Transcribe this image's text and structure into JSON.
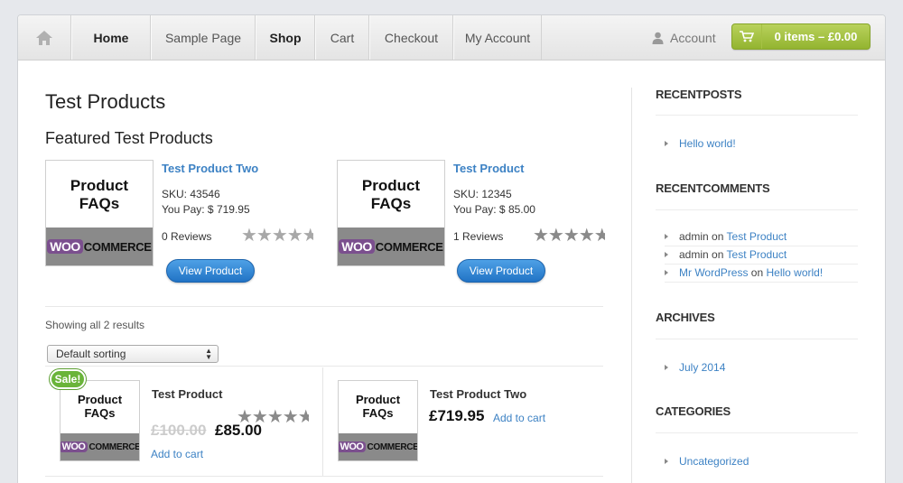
{
  "nav": {
    "items": [
      {
        "label": "Home",
        "bold": true
      },
      {
        "label": "Sample Page",
        "bold": false
      },
      {
        "label": "Shop",
        "bold": true
      },
      {
        "label": "Cart",
        "bold": false
      },
      {
        "label": "Checkout",
        "bold": false
      },
      {
        "label": "My Account",
        "bold": false
      }
    ],
    "account_label": "Account",
    "cart_label": "0 items – £0.00"
  },
  "main": {
    "page_title": "Test Products",
    "featured_title": "Featured Test Products",
    "featured": [
      {
        "name": "Test Product Two",
        "sku": "SKU: 43546",
        "price": "You Pay: $ 719.95",
        "reviews": "0 Reviews",
        "button": "View Product"
      },
      {
        "name": "Test Product",
        "sku": "SKU: 12345",
        "price": "You Pay: $ 85.00",
        "reviews": "1 Reviews",
        "button": "View Product"
      }
    ],
    "showing": "Showing all 2 results",
    "sorting_selected": "Default sorting",
    "shop": [
      {
        "name": "Test Product",
        "sale_badge": "Sale!",
        "old_price": "£100.00",
        "price": "£85.00",
        "add_to_cart": "Add to cart"
      },
      {
        "name": "Test Product Two",
        "price": "£719.95",
        "add_to_cart": "Add to cart"
      }
    ],
    "thumb": {
      "line1": "Product",
      "line2": "FAQs",
      "woo_tag": "WOO",
      "woo_rest": "COMMERCE"
    }
  },
  "sidebar": {
    "recent_posts": {
      "title": "RECENTPOSTS",
      "items": [
        "Hello world!"
      ]
    },
    "recent_comments": {
      "title": "RECENTCOMMENTS",
      "items": [
        {
          "author": "admin",
          "on": "on",
          "post": "Test Product"
        },
        {
          "author": "admin",
          "on": "on",
          "post": "Test Product"
        },
        {
          "author": "Mr WordPress",
          "on": "on",
          "post": "Hello world!"
        }
      ]
    },
    "archives": {
      "title": "ARCHIVES",
      "items": [
        "July 2014"
      ]
    },
    "categories": {
      "title": "CATEGORIES",
      "items": [
        "Uncategorized"
      ]
    }
  },
  "colors": {
    "link": "#3d82c4",
    "cart_green": "#93b430",
    "button_blue": "#2173c5",
    "sale_green": "#6ab43a",
    "woo_purple": "#7b4f8e"
  }
}
